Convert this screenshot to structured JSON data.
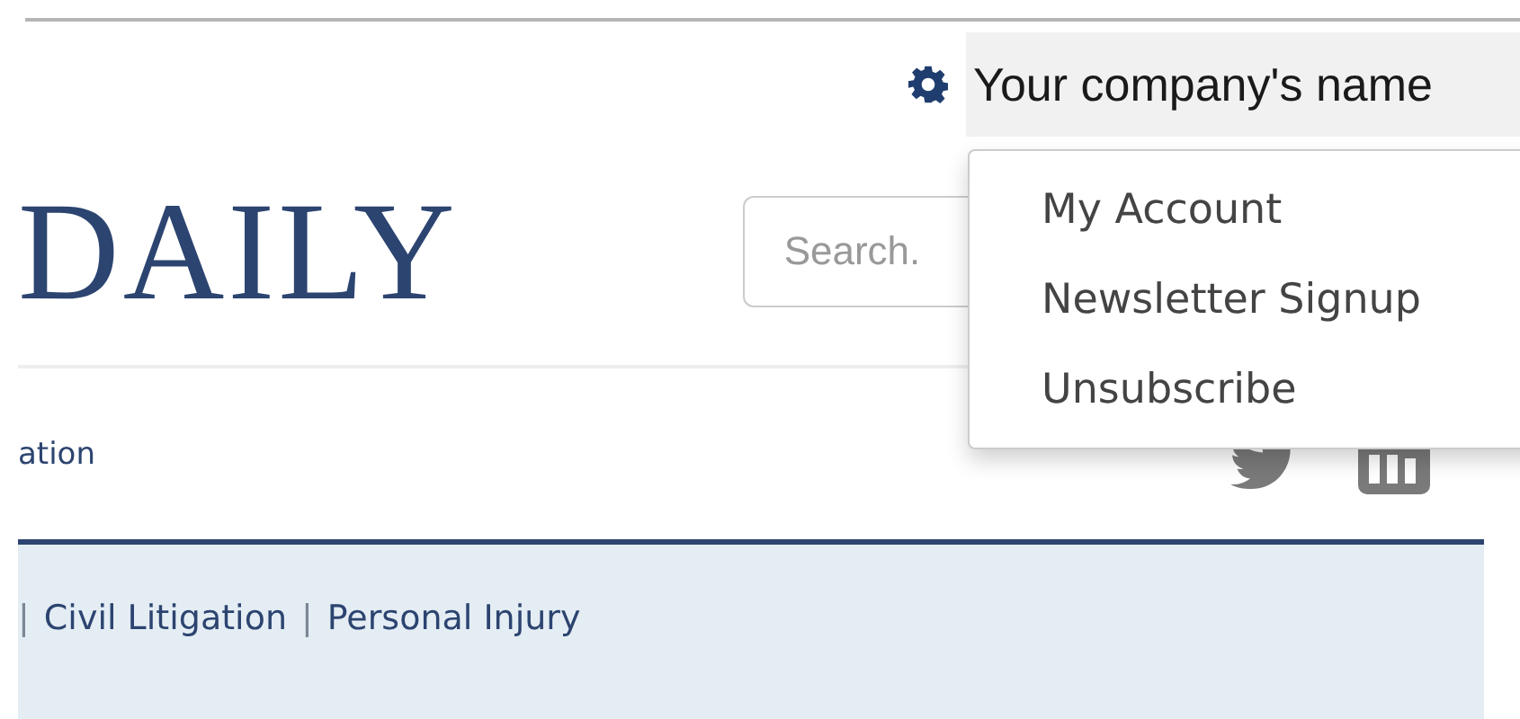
{
  "account_bar": {
    "company_name": "Your company's name"
  },
  "masthead": {
    "logo": "DAILY",
    "search": {
      "placeholder": "Search."
    }
  },
  "nav": {
    "items": [
      "ation"
    ]
  },
  "breadcrumb": [
    {
      "kind": "separator",
      "text": "|"
    },
    {
      "kind": "link",
      "text": "Civil Litigation"
    },
    {
      "kind": "separator",
      "text": "|"
    },
    {
      "kind": "link",
      "text": "Personal Injury"
    }
  ],
  "account_menu": {
    "items": [
      "My Account",
      "Newsletter Signup",
      "Unsubscribe"
    ]
  }
}
